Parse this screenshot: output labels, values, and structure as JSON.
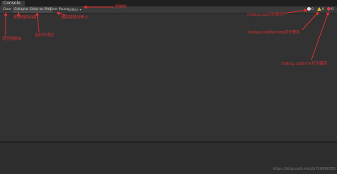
{
  "window": {
    "tab_title": "Console"
  },
  "toolbar": {
    "clear": "Clear",
    "collapse": "Collapse",
    "clear_on_play": "Clear on Play",
    "error_pause": "Error Pause",
    "editor": "Editor",
    "counters": {
      "log": "0",
      "warning": "0",
      "error": "0"
    }
  },
  "annotations": {
    "toolbar": "控制栏",
    "clear": "清空控制台",
    "collapse": "折叠相同内容",
    "clear_on_play": "运行时清空",
    "error_pause": "遇到错误时停止",
    "log": "Debug.Log打印提示",
    "warning": "Debug.LogWarning打印警告",
    "error": "Debug.LogError打印错误"
  },
  "watermark": "https://blog.csdn.net/zb756999355",
  "colors": {
    "annotation": "#e03030",
    "panel": "#323232",
    "toolbar": "#3a3a3a"
  }
}
